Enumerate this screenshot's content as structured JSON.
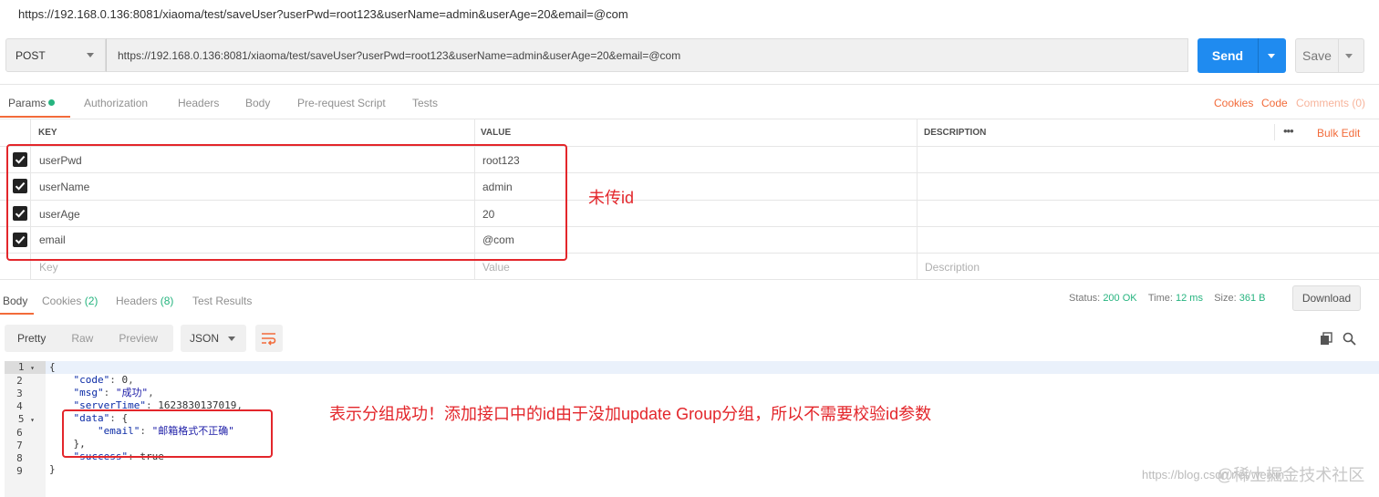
{
  "window": {
    "url_title": "https://192.168.0.136:8081/xiaoma/test/saveUser?userPwd=root123&userName=admin&userAge=20&email=@com"
  },
  "request": {
    "method": "POST",
    "url": "https://192.168.0.136:8081/xiaoma/test/saveUser?userPwd=root123&userName=admin&userAge=20&email=@com",
    "send_label": "Send",
    "save_label": "Save"
  },
  "request_tabs": [
    "Params",
    "Authorization",
    "Headers",
    "Body",
    "Pre-request Script",
    "Tests"
  ],
  "request_links": {
    "cookies": "Cookies",
    "code": "Code",
    "comments": "Comments (0)"
  },
  "params": {
    "headers": {
      "key": "KEY",
      "value": "VALUE",
      "description": "DESCRIPTION"
    },
    "more_icon": "•••",
    "bulk_edit": "Bulk Edit",
    "rows": [
      {
        "key": "userPwd",
        "value": "root123",
        "checked": true
      },
      {
        "key": "userName",
        "value": "admin",
        "checked": true
      },
      {
        "key": "userAge",
        "value": "20",
        "checked": true
      },
      {
        "key": "email",
        "value": "@com",
        "checked": true
      }
    ],
    "placeholders": {
      "key": "Key",
      "value": "Value",
      "description": "Description"
    }
  },
  "annotations": {
    "params_note": "未传id",
    "response_note": "表示分组成功！添加接口中的id由于没加update Group分组，所以不需要校验id参数"
  },
  "response_tabs": {
    "body": "Body",
    "cookies": "Cookies",
    "cookies_count": "(2)",
    "headers": "Headers",
    "headers_count": "(8)",
    "test_results": "Test Results"
  },
  "response_status": {
    "status_label": "Status:",
    "status_value": "200 OK",
    "time_label": "Time:",
    "time_value": "12 ms",
    "size_label": "Size:",
    "size_value": "361 B",
    "download": "Download"
  },
  "view_modes": {
    "pretty": "Pretty",
    "raw": "Raw",
    "preview": "Preview",
    "format": "JSON"
  },
  "code_lines": {
    "l1": "{",
    "l2_key": "\"code\"",
    "l2_val": "0",
    "l3_key": "\"msg\"",
    "l3_val": "\"成功\"",
    "l4_key": "\"serverTime\"",
    "l4_val": "1623830137019",
    "l5_key": "\"data\"",
    "l5_val": "{",
    "l6_key": "\"email\"",
    "l6_val": "\"邮箱格式不正确\"",
    "l7": "},",
    "l8_key": "\"success\"",
    "l8_val": "true",
    "l9": "}"
  },
  "watermark": {
    "csdn": "https://blog.csdn.net/weixin_",
    "juejin": "@稀土掘金技术社区"
  },
  "colors": {
    "accent": "#f26b3a",
    "send": "#1f8bf0",
    "ok": "#26b47f",
    "annotation": "#e3262b"
  }
}
